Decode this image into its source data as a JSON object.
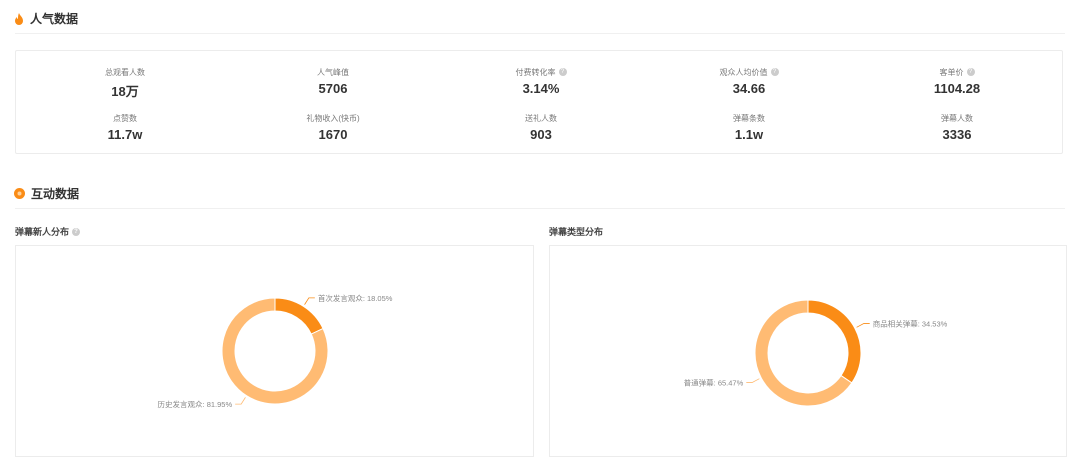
{
  "popularity": {
    "title": "人气数据",
    "stats": [
      {
        "label": "总观看人数",
        "value": "18万",
        "help": false
      },
      {
        "label": "人气峰值",
        "value": "5706",
        "help": false
      },
      {
        "label": "付费转化率",
        "value": "3.14%",
        "help": true
      },
      {
        "label": "观众人均价值",
        "value": "34.66",
        "help": true
      },
      {
        "label": "客单价",
        "value": "1104.28",
        "help": true
      },
      {
        "label": "点赞数",
        "value": "11.7w",
        "help": false
      },
      {
        "label": "礼物收入(快币)",
        "value": "1670",
        "help": false
      },
      {
        "label": "送礼人数",
        "value": "903",
        "help": false
      },
      {
        "label": "弹幕条数",
        "value": "1.1w",
        "help": false
      },
      {
        "label": "弹幕人数",
        "value": "3336",
        "help": false
      }
    ]
  },
  "interaction": {
    "title": "互动数据",
    "help_glyph": "?"
  },
  "colors": {
    "accent": "#fa8c16",
    "light": "#ffbb73"
  },
  "chart_data": [
    {
      "type": "pie",
      "title": "弹幕新人分布",
      "slices": [
        {
          "name": "首次发言观众",
          "value": 18.05,
          "label": "首次发言观众: 18.05%",
          "color": "#fa8c16"
        },
        {
          "name": "历史发言观众",
          "value": 81.95,
          "label": "历史发言观众: 81.95%",
          "color": "#ffbb73"
        }
      ]
    },
    {
      "type": "pie",
      "title": "弹幕类型分布",
      "slices": [
        {
          "name": "商品相关弹幕",
          "value": 34.53,
          "label": "商品相关弹幕: 34.53%",
          "color": "#fa8c16"
        },
        {
          "name": "普通弹幕",
          "value": 65.47,
          "label": "普通弹幕: 65.47%",
          "color": "#ffbb73"
        }
      ]
    }
  ]
}
